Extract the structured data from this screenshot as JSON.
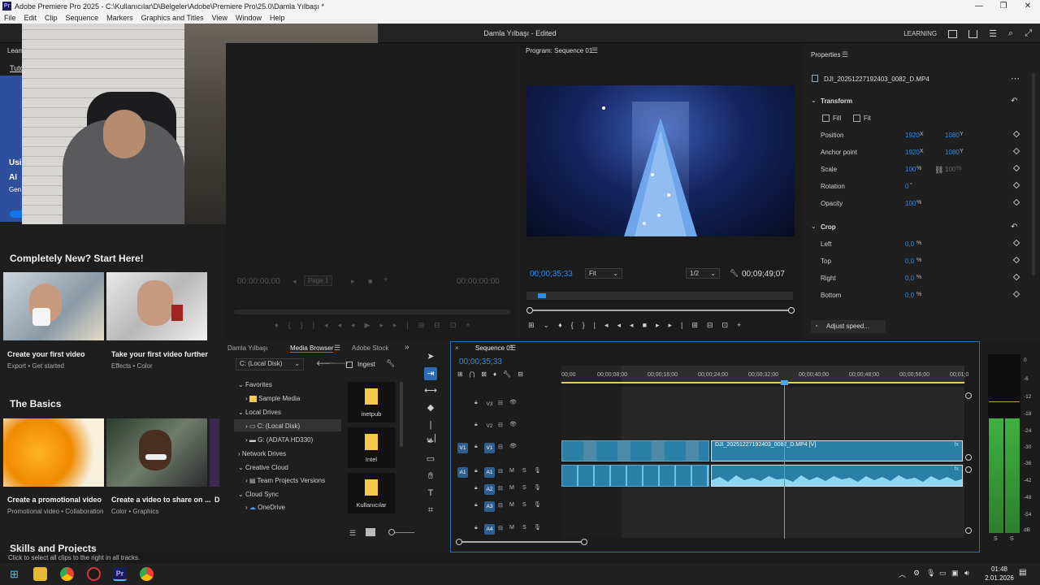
{
  "window": {
    "title": "Adobe Premiere Pro 2025 - C:\\Kullanıcılar\\D\\Belgeler\\Adobe\\Premiere Pro\\25.0\\Damla Yılbaşı *",
    "app_icon_label": "Pr",
    "minimize": "—",
    "maximize": "❐",
    "close": "✕"
  },
  "menu": [
    "File",
    "Edit",
    "Clip",
    "Sequence",
    "Markers",
    "Graphics and Titles",
    "View",
    "Window",
    "Help"
  ],
  "header": {
    "title": "Damla Yılbaşı - Edited",
    "workspace": "LEARNING"
  },
  "learn": {
    "section_new": "Completely New? Start Here!",
    "cards_new": [
      {
        "title": "Create your first video",
        "sub": "Export • Get started"
      },
      {
        "title": "Take your first video further",
        "sub": "Effects • Color"
      }
    ],
    "section_basics": "The Basics",
    "cards_basics": [
      {
        "title": "Create a promotional video",
        "sub": "Promotional video • Collaboration"
      },
      {
        "title": "Create a video to share on ...",
        "sub": "Color • Graphics"
      }
    ],
    "section_skills": "Skills and Projects",
    "left_clip_texts": [
      "Learn",
      "Tuto",
      "Usi",
      "AI",
      "Gen"
    ],
    "extra_card_letter": "D"
  },
  "source": {
    "tc_left": "00:00:00:00",
    "tc_right": "00:00:00:00",
    "page_label": "Page 1"
  },
  "program": {
    "title": "Program: Sequence 01",
    "timecode": "00;00;35;33",
    "fit": "Fit",
    "resolution": "1/2",
    "duration": "00;09;49;07"
  },
  "properties": {
    "title": "Properties",
    "clip": "DJI_20251227192403_0082_D.MP4",
    "transform": "Transform",
    "fill": "Fill",
    "fit": "Fit",
    "rows": [
      {
        "label": "Position",
        "v1": "1920",
        "u1": "X",
        "v2": "1080",
        "u2": "Y"
      },
      {
        "label": "Anchor point",
        "v1": "1920",
        "u1": "X",
        "v2": "1080",
        "u2": "Y"
      },
      {
        "label": "Scale",
        "v1": "100",
        "u1": "%",
        "v2": "100",
        "u2": "%"
      },
      {
        "label": "Rotation",
        "v1": "0",
        "u1": "°",
        "v2": "",
        "u2": ""
      },
      {
        "label": "Opacity",
        "v1": "100",
        "u1": "%",
        "v2": "",
        "u2": ""
      }
    ],
    "crop": "Crop",
    "crop_rows": [
      {
        "label": "Left",
        "v1": "0,0",
        "u1": "%"
      },
      {
        "label": "Top",
        "v1": "0,0",
        "u1": "%"
      },
      {
        "label": "Right",
        "v1": "0,0",
        "u1": "%"
      },
      {
        "label": "Bottom",
        "v1": "0,0",
        "u1": "%"
      }
    ],
    "adjust_speed": "Adjust speed..."
  },
  "media": {
    "tabs": [
      "Damla Yılbaşı",
      "Media Browser",
      "Adobe Stock"
    ],
    "drive": "C: (Local Disk)",
    "ingest": "Ingest",
    "tree": [
      {
        "label": "Favorites",
        "kind": "group"
      },
      {
        "label": "Sample Media",
        "kind": "item"
      },
      {
        "label": "Local Drives",
        "kind": "group"
      },
      {
        "label": "C: (Local Disk)",
        "kind": "item"
      },
      {
        "label": "G: (ADATA HD330)",
        "kind": "item"
      },
      {
        "label": "Network Drives",
        "kind": "group"
      },
      {
        "label": "Creative Cloud",
        "kind": "group"
      },
      {
        "label": "Team Projects Versions",
        "kind": "item"
      },
      {
        "label": "Cloud Sync",
        "kind": "group"
      },
      {
        "label": "OneDrive",
        "kind": "item"
      }
    ],
    "folders": [
      "inetpub",
      "Intel",
      "Kullanıcılar"
    ]
  },
  "timeline": {
    "tab": "Sequence 01",
    "timecode": "00;00;35;33",
    "ruler": [
      "00;00",
      "00;00;08;00",
      "00;00;16;00",
      "00;00;24;00",
      "00;00;32;00",
      "00;00;40;00",
      "00;00;48;00",
      "00;00;56;00",
      "00;01;0"
    ],
    "video_tracks": [
      "V3",
      "V2",
      "V1"
    ],
    "audio_tracks": [
      "A1",
      "A2",
      "A3",
      "A4"
    ],
    "source_v": "V1",
    "source_a": "A1",
    "clip_label": "DJI_20251227192403_0082_D.MP4 [V]",
    "mute": "M",
    "solo": "S",
    "fx": "fx"
  },
  "meters": {
    "scale": [
      "0",
      "-6",
      "-12",
      "-18",
      "-24",
      "-30",
      "-36",
      "-42",
      "-48",
      "-54",
      "dB"
    ],
    "solo": [
      "S",
      "S"
    ]
  },
  "status": "Click to select all clips to the right in all tracks.",
  "taskbar": {
    "time": "01:48",
    "date": "2.01.2026"
  },
  "colors": {
    "accent": "#2d8ceb",
    "clip": "#2a7fa6",
    "playhead": "#4aa3ff",
    "meter": "#46c44a"
  }
}
